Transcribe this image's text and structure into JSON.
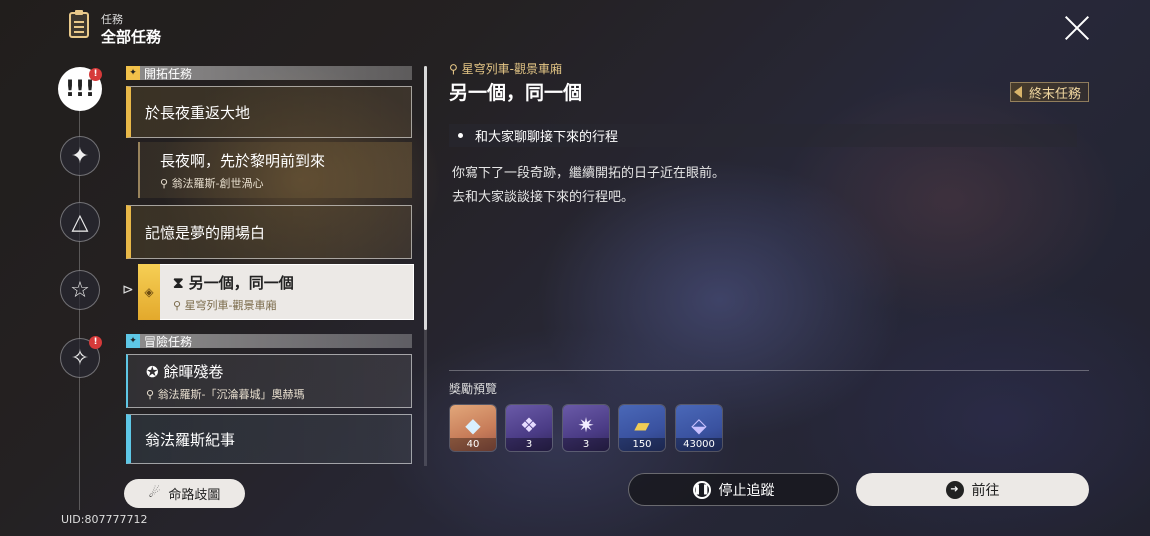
{
  "header": {
    "subtitle": "任務",
    "title": "全部任務"
  },
  "rail": {
    "active_icon": "!!!",
    "badge": "!"
  },
  "sections": {
    "trailblaze": {
      "label": "開拓任務"
    },
    "adventure": {
      "label": "冒險任務"
    }
  },
  "quests": {
    "q1": {
      "title": "於長夜重返大地"
    },
    "q2": {
      "title": "長夜啊，先於黎明前到來",
      "location": "翁法羅斯-創世渦心"
    },
    "q3": {
      "title": "記憶是夢的開場白"
    },
    "q4": {
      "title": "另一個，同一個",
      "location": "星穹列車-觀景車廂"
    },
    "q5": {
      "title": "餘暉殘卷",
      "location": "翁法羅斯-「沉淪暮城」奧赫瑪"
    },
    "q6": {
      "title": "翁法羅斯紀事"
    }
  },
  "path_button": "命路歧圖",
  "uid": "UID:807777712",
  "detail": {
    "location": "星穹列車-觀景車廂",
    "title": "另一個，同一個",
    "tag": "終末任務",
    "objective": "和大家聊聊接下來的行程",
    "desc_line1": "你寫下了一段奇跡，繼續開拓的日子近在眼前。",
    "desc_line2": "去和大家談談接下來的行程吧。"
  },
  "rewards": {
    "label": "獎勵預覽",
    "items": [
      {
        "icon": "stellar-jade-icon",
        "count": "40"
      },
      {
        "icon": "exp-material-icon",
        "count": "3"
      },
      {
        "icon": "refine-material-icon",
        "count": "3"
      },
      {
        "icon": "ticket-icon",
        "count": "150"
      },
      {
        "icon": "credit-icon",
        "count": "43000"
      }
    ]
  },
  "buttons": {
    "stop": "停止追蹤",
    "go": "前往"
  },
  "colors": {
    "gold": "#e8b848",
    "blue": "#5ec7e6",
    "red": "#d63a3a"
  }
}
